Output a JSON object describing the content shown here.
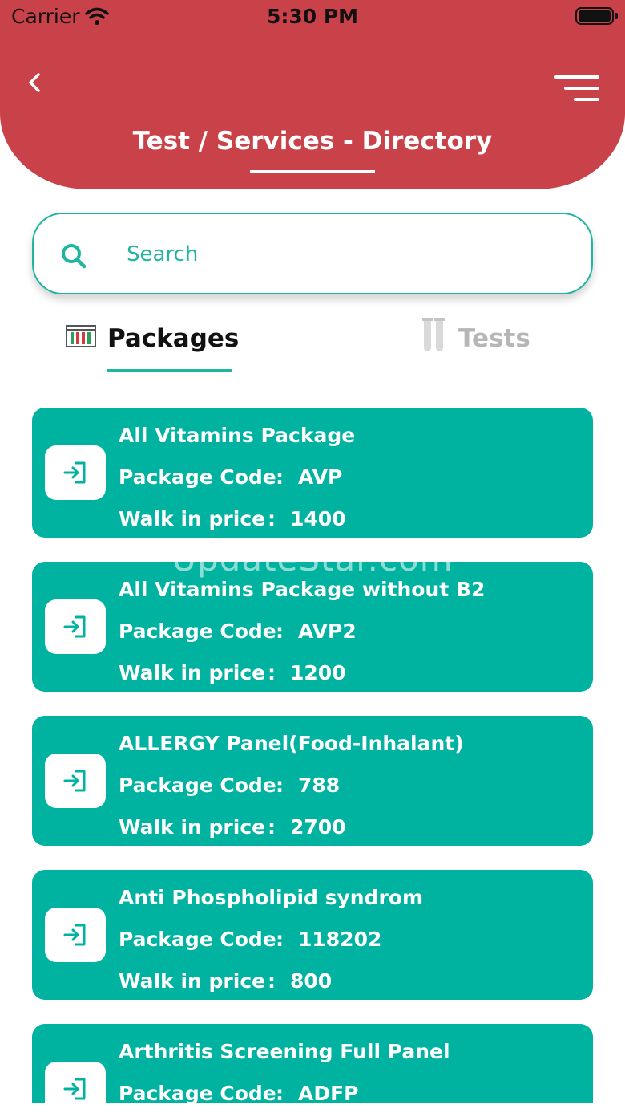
{
  "status_bar": {
    "carrier": "Carrier",
    "time": "5:30 PM"
  },
  "header": {
    "title": "Test / Services - Directory"
  },
  "search": {
    "placeholder": "Search"
  },
  "tabs": [
    {
      "label": "Packages",
      "active": true
    },
    {
      "label": "Tests",
      "active": false
    }
  ],
  "card_labels": {
    "code": "Package Code",
    "price": "Walk in price",
    "separator": ":"
  },
  "packages": [
    {
      "name": "All Vitamins Package",
      "code": "AVP",
      "price": "1400"
    },
    {
      "name": "All Vitamins Package without B2",
      "code": "AVP2",
      "price": "1200"
    },
    {
      "name": "ALLERGY Panel(Food-Inhalant)",
      "code": "788",
      "price": "2700"
    },
    {
      "name": "Anti Phospholipid syndrom",
      "code": "118202",
      "price": "800"
    },
    {
      "name": "Arthritis Screening Full Panel",
      "code": "ADFP",
      "price": ""
    }
  ],
  "watermark": "UpdateStar.com",
  "colors": {
    "header": "#c94149",
    "accent": "#00b3a1",
    "inactive": "#b6b6b6"
  },
  "icons": [
    "back-icon",
    "menu-icon",
    "search-icon",
    "packages-icon",
    "tests-icon",
    "login-icon",
    "wifi-icon",
    "battery-icon"
  ]
}
